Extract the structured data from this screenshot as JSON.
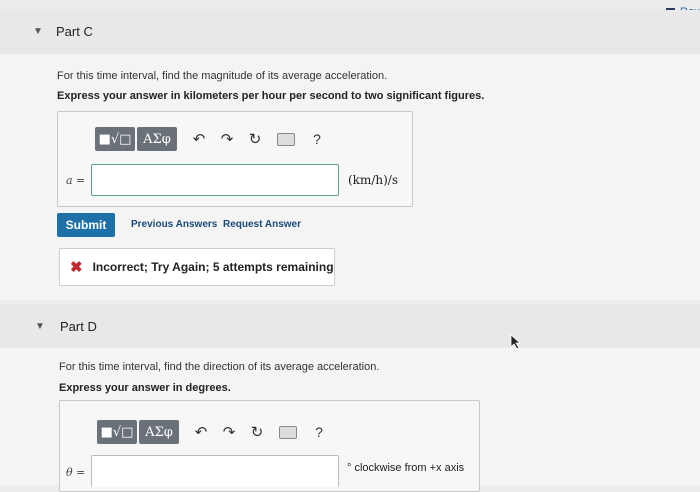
{
  "review_link": "Rev",
  "part_c": {
    "title": "Part C",
    "question": "For this time interval, find the magnitude of its average acceleration.",
    "instruction": "Express your answer in kilometers per hour per second to two significant figures.",
    "toolbar": {
      "fraction_btn": "■√□",
      "greek_btn": "ΑΣφ",
      "help": "?"
    },
    "input_label": "a =",
    "input_value": "",
    "unit": "(km/h)/s",
    "submit_label": "Submit",
    "previous_answers": "Previous Answers",
    "request_answer": "Request Answer",
    "feedback": "Incorrect; Try Again; 5 attempts remaining"
  },
  "part_d": {
    "title": "Part D",
    "question": "For this time interval, find the direction of its average acceleration.",
    "instruction": "Express your answer in degrees.",
    "toolbar": {
      "fraction_btn": "■√□",
      "greek_btn": "ΑΣφ",
      "help": "?"
    },
    "input_label": "θ =",
    "input_value": "",
    "unit": "° clockwise from +x axis"
  }
}
